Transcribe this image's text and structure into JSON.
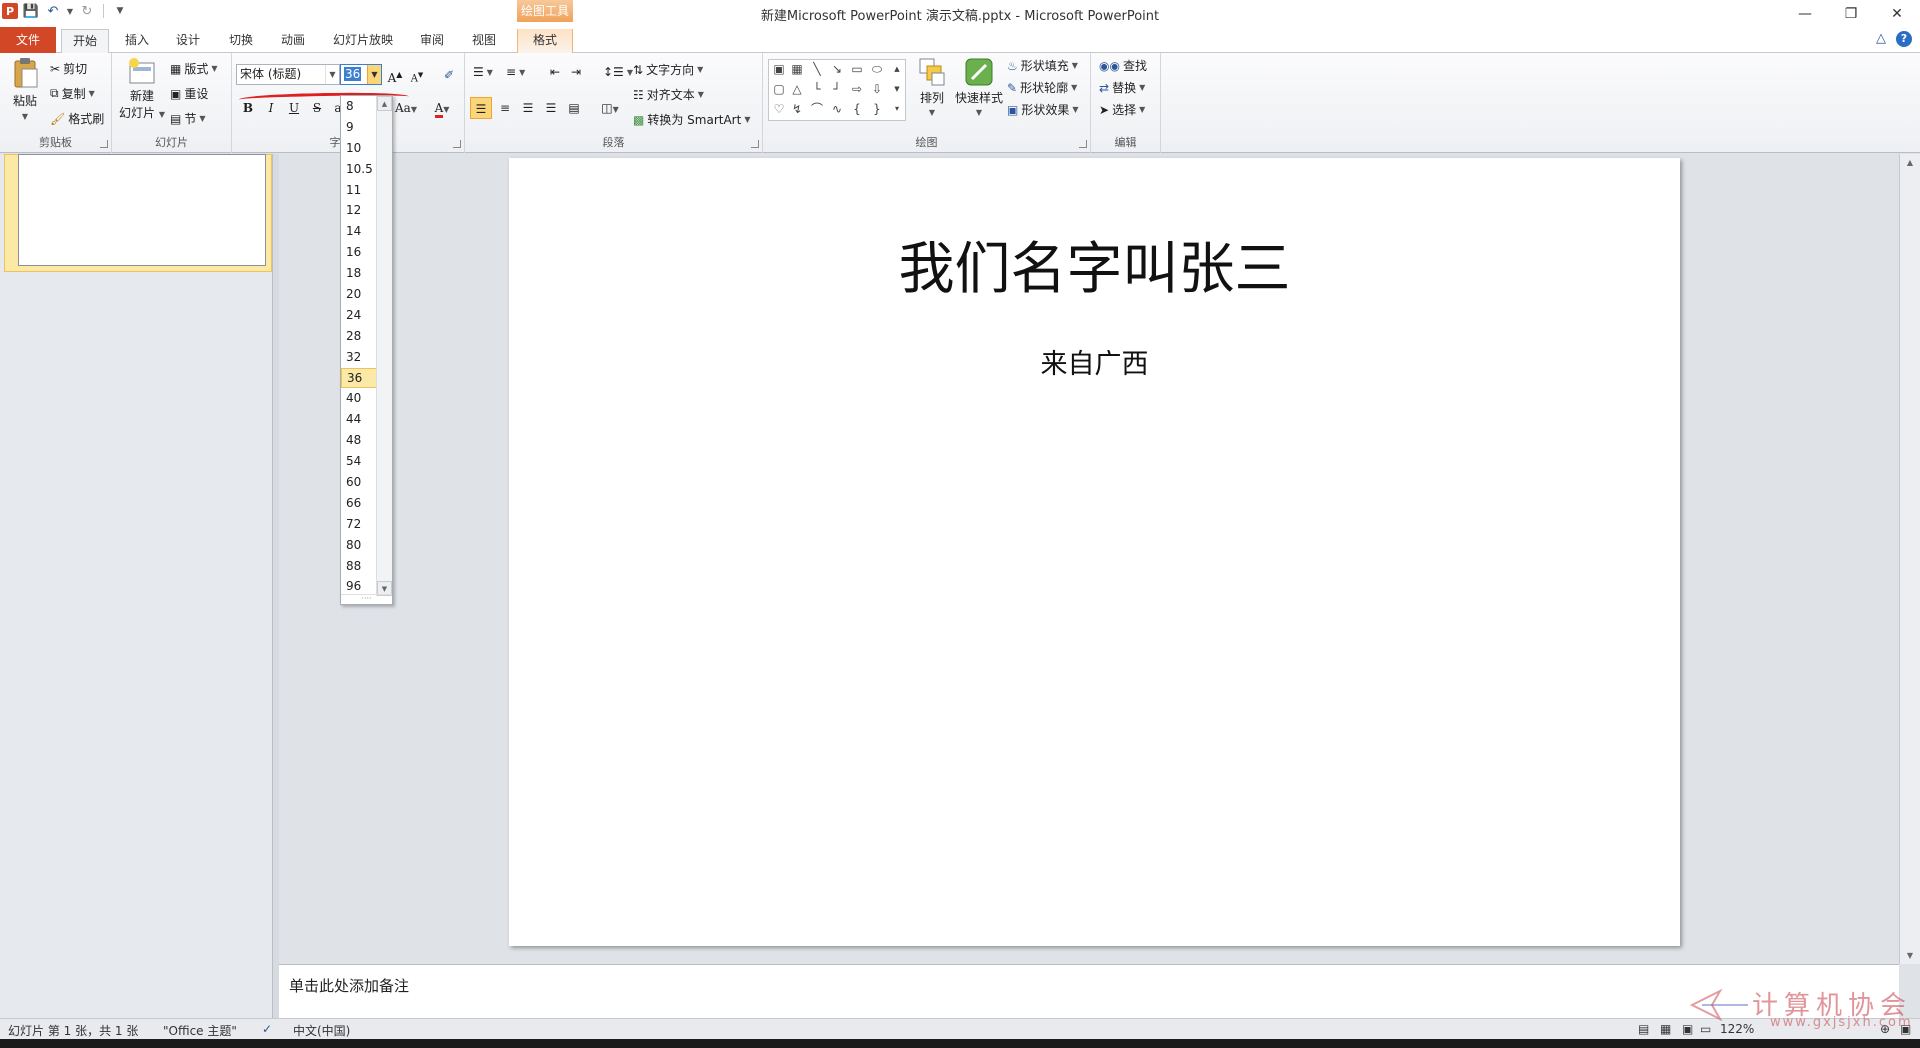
{
  "app": {
    "title": "新建Microsoft PowerPoint 演示文稿.pptx - Microsoft PowerPoint",
    "context_tab_header": "绘图工具",
    "logo": "P"
  },
  "tabs": [
    {
      "label": "文件"
    },
    {
      "label": "开始"
    },
    {
      "label": "插入"
    },
    {
      "label": "设计"
    },
    {
      "label": "切换"
    },
    {
      "label": "动画"
    },
    {
      "label": "幻灯片放映"
    },
    {
      "label": "审阅"
    },
    {
      "label": "视图"
    },
    {
      "label": "格式"
    }
  ],
  "ribbon": {
    "clipboard": {
      "label": "剪贴板",
      "paste": "粘贴",
      "cut": "剪切",
      "copy": "复制",
      "format_painter": "格式刷"
    },
    "slides": {
      "label": "幻灯片",
      "new_slide_1": "新建",
      "new_slide_2": "幻灯片",
      "layout": "版式",
      "reset": "重设",
      "section": "节"
    },
    "font": {
      "label": "字",
      "font_name": "宋体 (标题)",
      "font_size": "36",
      "grow": "A",
      "shrink": "A",
      "bold": "B",
      "italic": "I",
      "underline": "U",
      "strike": "S",
      "shadow": "a",
      "change_case": "Aa",
      "font_color": "A"
    },
    "paragraph": {
      "label": "段落",
      "text_direction": "文字方向",
      "align_text": "对齐文本",
      "convert_smartart": "转换为 SmartArt"
    },
    "drawing": {
      "label": "绘图",
      "arrange": "排列",
      "quick_styles": "快速样式",
      "shape_fill": "形状填充",
      "shape_outline": "形状轮廓",
      "shape_effects": "形状效果"
    },
    "editing": {
      "label": "编辑",
      "find": "查找",
      "replace": "替换",
      "select": "选择"
    }
  },
  "font_size_dropdown": {
    "items": [
      "8",
      "9",
      "10",
      "10.5",
      "11",
      "12",
      "14",
      "16",
      "18",
      "20",
      "24",
      "28",
      "32",
      "36",
      "40",
      "44",
      "48",
      "54",
      "60",
      "66",
      "72",
      "80",
      "88",
      "96"
    ],
    "selected": "36"
  },
  "slide": {
    "title": "我们名字叫张三",
    "subtitle": "来自广西"
  },
  "notes": {
    "placeholder": "单击此处添加备注"
  },
  "statusbar": {
    "slide_info": "幻灯片 第 1 张，共 1 张",
    "theme": "\"Office 主题\"",
    "language": "中文(中国)",
    "zoom": "122%"
  },
  "watermark": {
    "text": "计算机协会",
    "url": "www.gxjsjxh.com"
  },
  "colors": {
    "file_tab": "#d24726",
    "accent": "#2b579a",
    "context_tab": "#f0a15a",
    "selection": "#fde9a6",
    "annotation_red": "#e02020"
  }
}
